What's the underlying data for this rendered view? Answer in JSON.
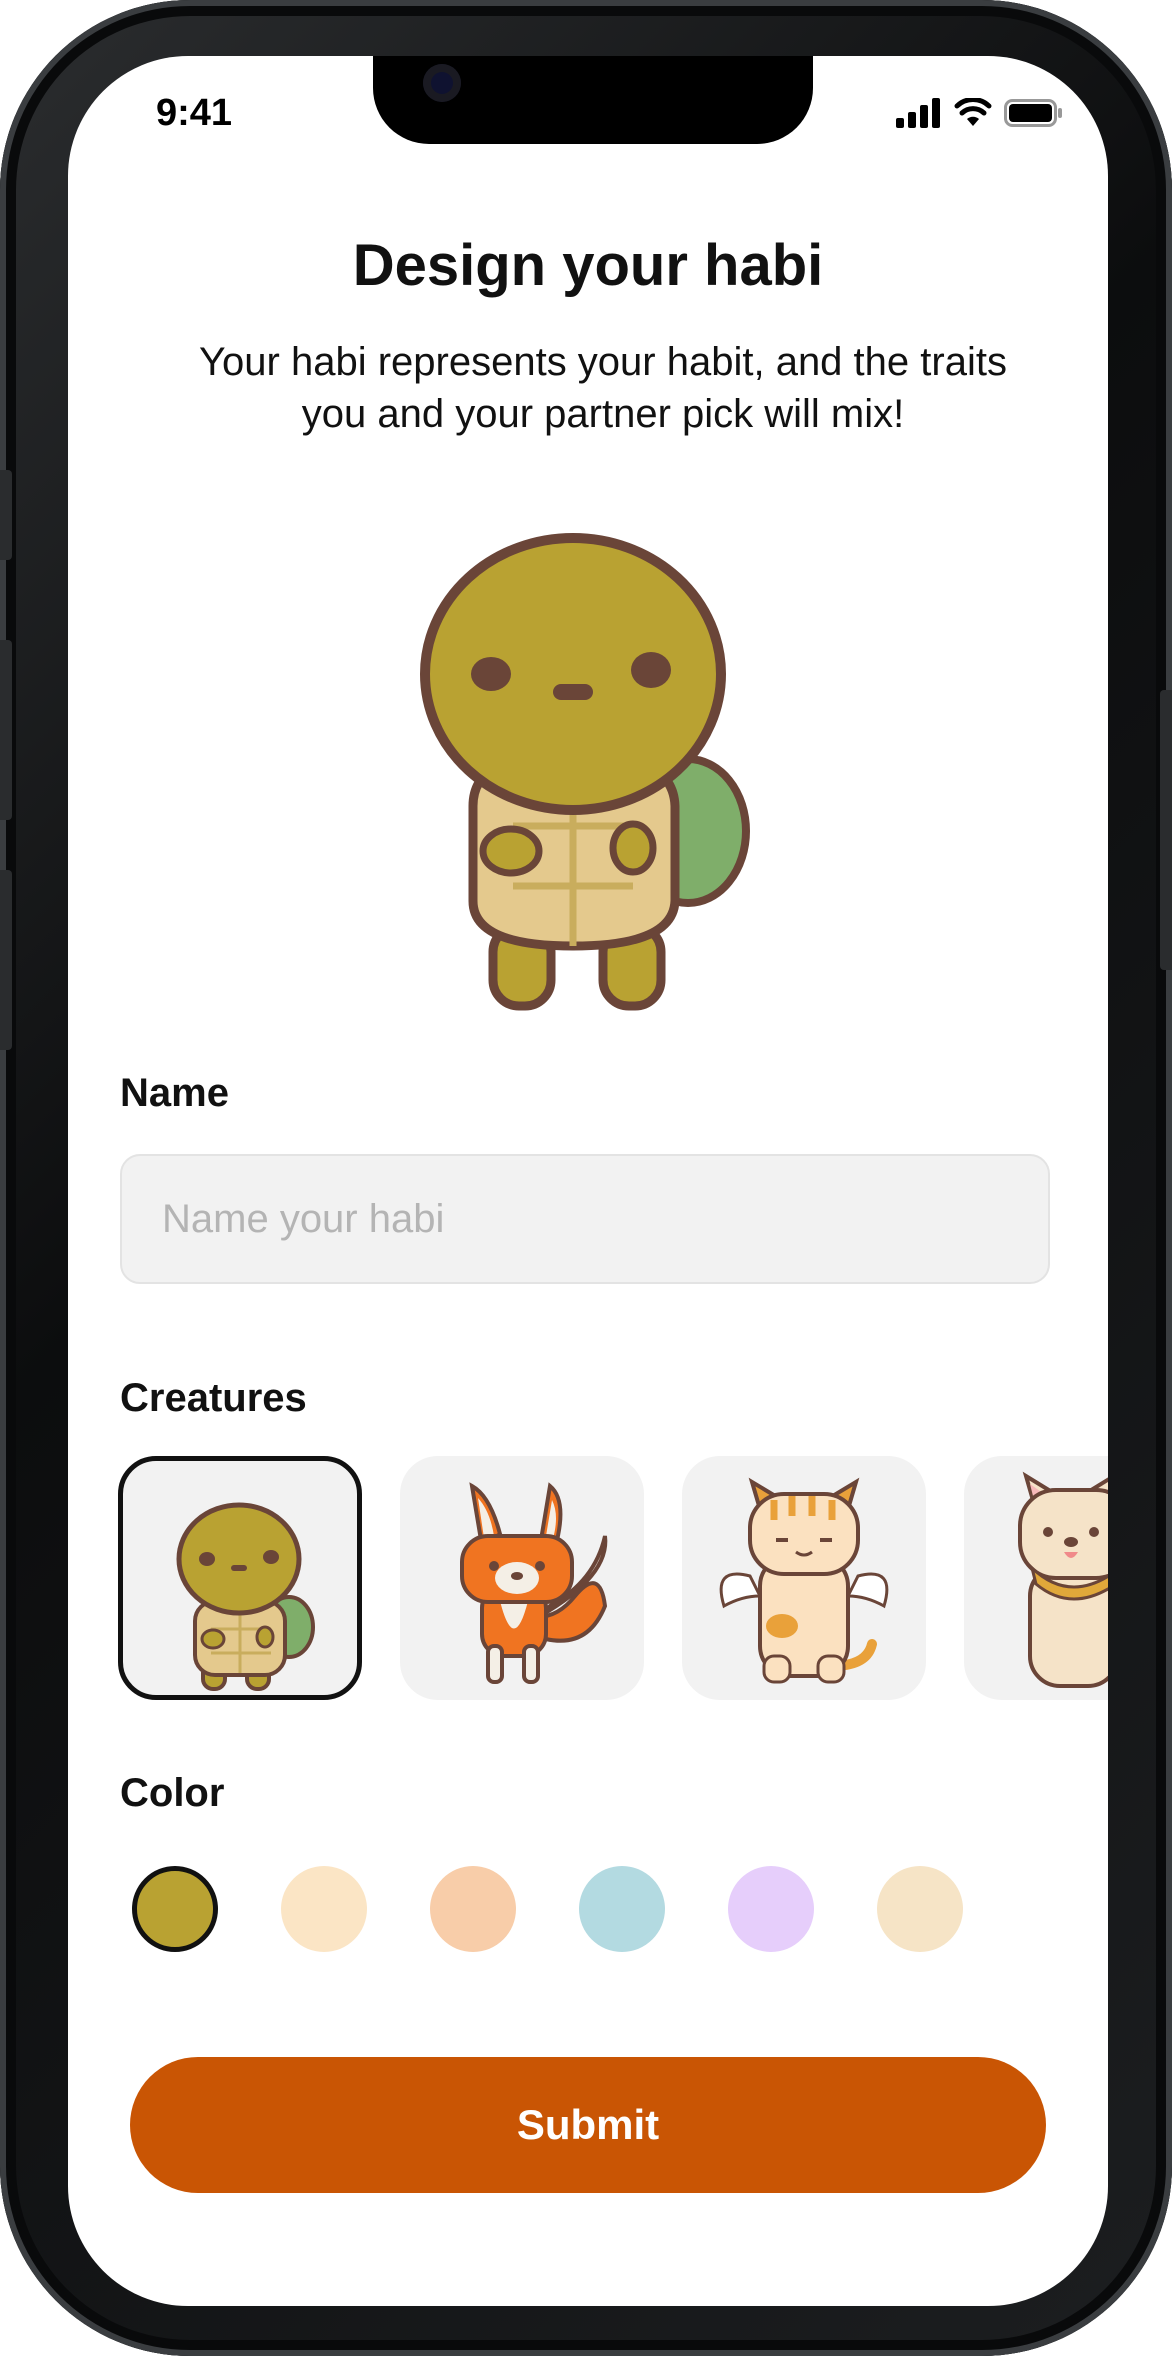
{
  "status_bar": {
    "time": "9:41"
  },
  "header": {
    "title": "Design your habi",
    "subtitle": "Your habi represents your habit, and the traits you and your partner pick will mix!"
  },
  "name_section": {
    "label": "Name",
    "placeholder": "Name your habi",
    "value": ""
  },
  "creatures_section": {
    "label": "Creatures",
    "items": [
      {
        "icon": "turtle-icon",
        "selected": true
      },
      {
        "icon": "fox-icon",
        "selected": false
      },
      {
        "icon": "cat-icon",
        "selected": false
      },
      {
        "icon": "dog-icon",
        "selected": false
      }
    ]
  },
  "color_section": {
    "label": "Color",
    "swatches": [
      "#B9A232",
      "#FBE5C5",
      "#F8CDA9",
      "#B3DAE1",
      "#E6CEFB",
      "#F6E4C6"
    ],
    "selected_index": 0
  },
  "submit": {
    "label": "Submit",
    "color": "#C95504"
  }
}
